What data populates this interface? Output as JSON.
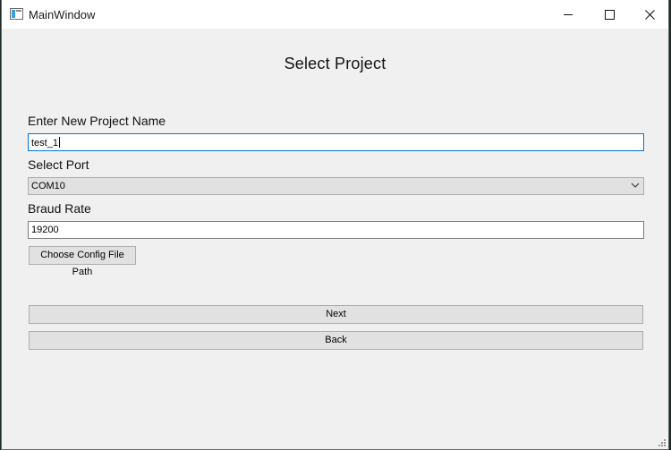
{
  "window": {
    "title": "MainWindow"
  },
  "page": {
    "heading": "Select Project"
  },
  "project_name": {
    "label": "Enter New Project Name",
    "value": "test_1"
  },
  "port": {
    "label": "Select Port",
    "selected": "COM10"
  },
  "baud": {
    "label": "Braud Rate",
    "value": "19200"
  },
  "buttons": {
    "config": "Choose Config File Path",
    "next": "Next",
    "back": "Back"
  },
  "icons": {
    "app": "app-window-icon",
    "minimize": "minimize-icon",
    "maximize": "maximize-icon",
    "close": "close-icon",
    "dropdown": "chevron-down-icon",
    "grip": "resize-grip-icon"
  },
  "colors": {
    "focus_border": "#0078d7",
    "window_bg": "#f0f0f0",
    "button_bg": "#e1e1e1"
  }
}
